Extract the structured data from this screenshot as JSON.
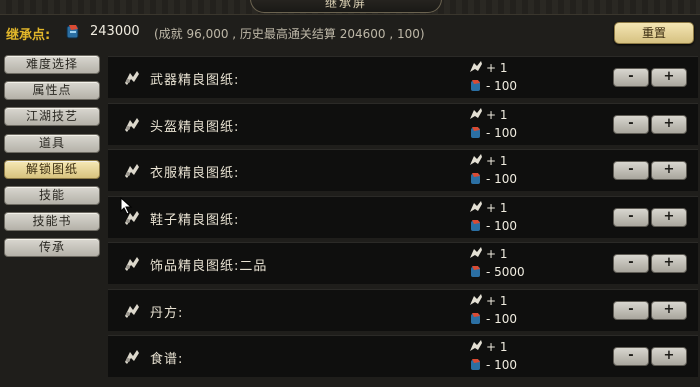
{
  "header": {
    "title": "继承屏",
    "inherit_label": "继承点:",
    "points": "243000",
    "note": "(成就 96,000 , 历史最高通关结算 204600 , 100)",
    "reset_label": "重置"
  },
  "sidebar": {
    "items": [
      {
        "label": "难度选择",
        "active": false
      },
      {
        "label": "属性点",
        "active": false
      },
      {
        "label": "江湖技艺",
        "active": false
      },
      {
        "label": "道具",
        "active": false
      },
      {
        "label": "解锁图纸",
        "active": true
      },
      {
        "label": "技能",
        "active": false
      },
      {
        "label": "技能书",
        "active": false
      },
      {
        "label": "传承",
        "active": false
      }
    ]
  },
  "rows": [
    {
      "name": "武器精良图纸:",
      "gain": "+ 1",
      "cost": "- 100"
    },
    {
      "name": "头盔精良图纸:",
      "gain": "+ 1",
      "cost": "- 100"
    },
    {
      "name": "衣服精良图纸:",
      "gain": "+ 1",
      "cost": "- 100"
    },
    {
      "name": "鞋子精良图纸:",
      "gain": "+ 1",
      "cost": "- 100"
    },
    {
      "name": "饰品精良图纸:二品",
      "gain": "+ 1",
      "cost": "- 5000"
    },
    {
      "name": "丹方:",
      "gain": "+ 1",
      "cost": "- 100"
    },
    {
      "name": "食谱:",
      "gain": "+ 1",
      "cost": "- 100"
    }
  ],
  "buttons": {
    "minus": "-",
    "plus": "+"
  },
  "colors": {
    "accent_gold": "#e1b62a",
    "active_tab": "#f7e9b6"
  }
}
